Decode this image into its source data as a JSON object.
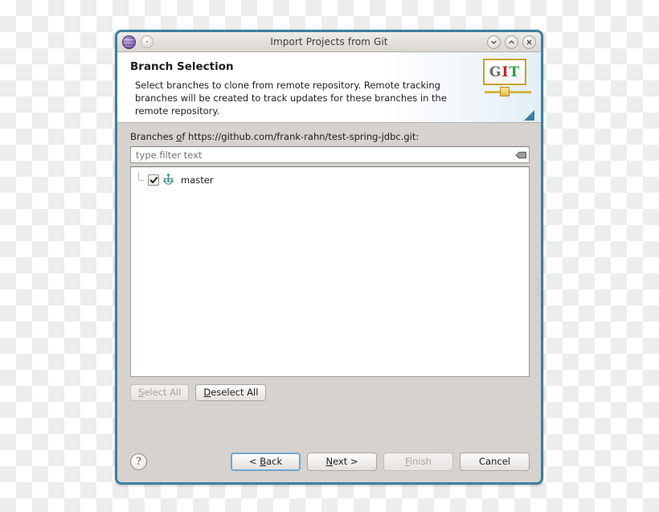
{
  "window": {
    "title": "Import Projects from Git",
    "app_icon": "eclipse-globe-icon",
    "menu_icon": "window-menu-icon",
    "controls": [
      {
        "name": "minimize-button",
        "glyph": "chevron-down-icon"
      },
      {
        "name": "maximize-button",
        "glyph": "chevron-up-icon"
      },
      {
        "name": "close-button",
        "glyph": "close-x-icon"
      }
    ],
    "border_color": "#3d7f9e"
  },
  "header": {
    "title": "Branch Selection",
    "description": "Select branches to clone from remote repository. Remote tracking branches will be created to track updates for these branches in the remote repository.",
    "logo": {
      "name": "git-logo",
      "letters": [
        "G",
        "I",
        "T"
      ],
      "colors": {
        "g": "#6b6b6b",
        "i": "#cc2222",
        "t": "#2e9e4a",
        "frame": "#c9a227"
      }
    }
  },
  "main": {
    "branches_label_prefix": "Branches ",
    "branches_label_mnemonic": "o",
    "branches_label_suffix": "f https://github.com/frank-rahn/test-spring-jdbc.git:",
    "repository_url": "https://github.com/frank-rahn/test-spring-jdbc.git",
    "filter": {
      "value": "",
      "placeholder": "type filter text",
      "clear_icon": "clear-filter-eraser-icon"
    },
    "tree": {
      "items": [
        {
          "label": "master",
          "checked": true,
          "icon": "git-branch-icon"
        }
      ]
    },
    "select_buttons": [
      {
        "name": "select-all-button",
        "prefix": "",
        "mnemonic": "S",
        "suffix": "elect All",
        "enabled": false
      },
      {
        "name": "deselect-all-button",
        "prefix": "",
        "mnemonic": "D",
        "suffix": "eselect All",
        "enabled": true
      }
    ]
  },
  "footer": {
    "help": {
      "name": "help-button",
      "glyph": "?"
    },
    "buttons": [
      {
        "name": "back-button",
        "prefix": "< ",
        "mnemonic": "B",
        "suffix": "ack",
        "enabled": true,
        "focused": true
      },
      {
        "name": "next-button",
        "prefix": "",
        "mnemonic": "N",
        "suffix": "ext >",
        "enabled": true,
        "focused": false
      },
      {
        "name": "finish-button",
        "prefix": "",
        "mnemonic": "F",
        "suffix": "inish",
        "enabled": false,
        "focused": false
      },
      {
        "name": "cancel-button",
        "prefix": "",
        "mnemonic": "",
        "suffix": "Cancel",
        "enabled": true,
        "focused": false
      }
    ]
  }
}
